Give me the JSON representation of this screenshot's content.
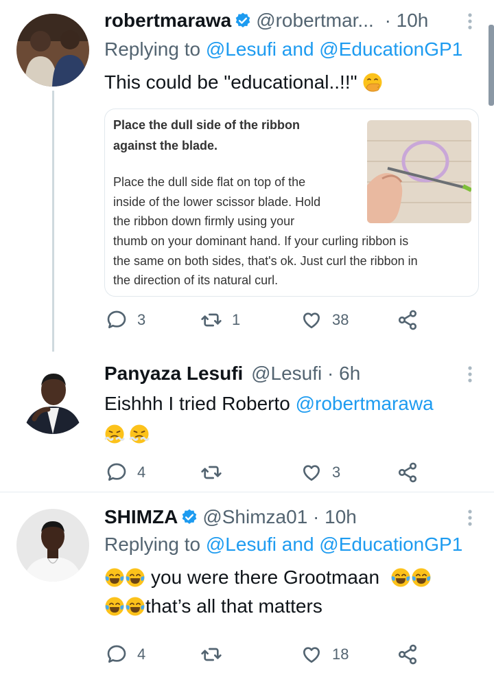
{
  "tweets": [
    {
      "name": "robertmarawa",
      "verified": true,
      "handle": "@robertmar...",
      "time": "· 10h",
      "reply_prefix": "Replying to ",
      "reply_targets": "@Lesufi and @EducationGP1",
      "text": "This could be \"educational..!!\"",
      "emoji": "hand-over-mouth",
      "card": {
        "title": "Place the dull side of the ribbon against the blade.",
        "body1": "Place the dull side flat on top of the\ninside of the lower scissor blade. Hold\nthe ribbon down firmly using your",
        "body2": "thumb on your dominant hand. If your curling ribbon is\nthe same on both sides, that's ok. Just curl the ribbon in\nthe direction of its natural curl.",
        "image": "scissors-curling-ribbon"
      },
      "replies": "3",
      "retweets": "1",
      "likes": "38"
    },
    {
      "name": "Panyaza Lesufi",
      "verified": false,
      "handle": "@Lesufi",
      "time": "· 6h",
      "text_prefix": "Eishhh I tried Roberto ",
      "text_mention": "@robertmarawa",
      "emoji": "face-with-steam",
      "replies": "4",
      "retweets": "",
      "likes": "3"
    },
    {
      "name": "SHIMZA",
      "verified": true,
      "handle": "@Shimza01",
      "time": "· 10h",
      "reply_prefix": "Replying to ",
      "reply_targets": "@Lesufi and @EducationGP1",
      "text_line1": "you were there Grootmaan",
      "text_line2": "that’s all that matters",
      "emoji": "tears-of-joy",
      "replies": "4",
      "retweets": "",
      "likes": "18"
    }
  ],
  "colors": {
    "accent": "#1d9bf0",
    "muted": "#536471",
    "verified": "#1d9bf0"
  },
  "icons": [
    "reply-icon",
    "retweet-icon",
    "like-icon",
    "share-icon",
    "more-icon",
    "verified-badge-icon"
  ]
}
